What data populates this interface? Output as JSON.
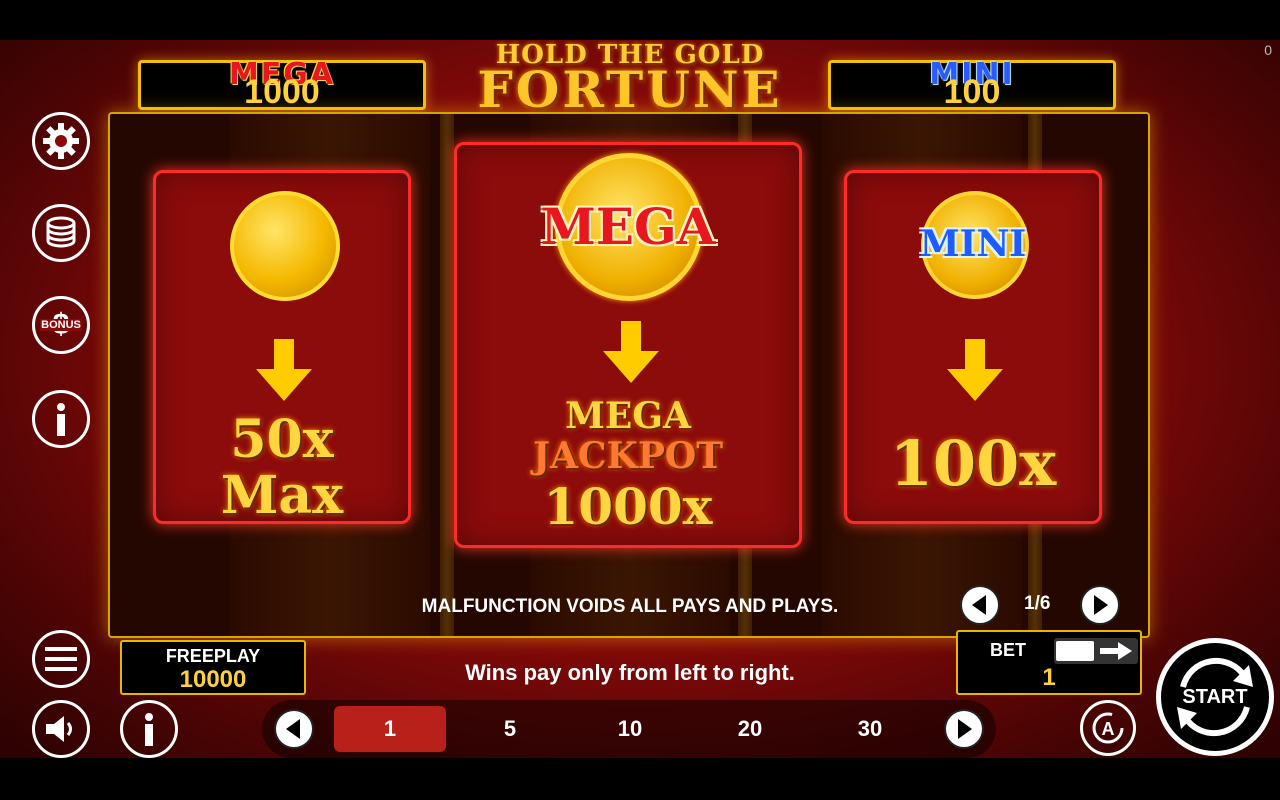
{
  "jackpots": {
    "mega": {
      "label": "MEGA",
      "value": "1000"
    },
    "mini": {
      "label": "MINI",
      "value": "100"
    }
  },
  "logo": {
    "line1": "HOLD THE GOLD",
    "line2": "FORTUNE"
  },
  "corner_counter": "0",
  "panels": {
    "left": {
      "line1": "50x",
      "line2": "Max"
    },
    "center": {
      "coin_label": "MEGA",
      "line1": "MEGA",
      "line2": "JACKPOT",
      "line3": "1000x"
    },
    "right": {
      "coin_label": "MINI",
      "line1": "100x"
    }
  },
  "disclaimer": "MALFUNCTION VOIDS ALL PAYS AND PLAYS.",
  "pager": {
    "current": "1/6"
  },
  "side_menu": {
    "bonus_label": "BONUS"
  },
  "freeplay": {
    "label": "FREEPLAY",
    "value": "10000"
  },
  "wins_text": "Wins pay only from left to right.",
  "bet": {
    "label": "BET",
    "value": "1"
  },
  "bet_options": [
    "1",
    "5",
    "10",
    "20",
    "30"
  ],
  "bet_selected": "1",
  "start_label": "START",
  "colors": {
    "accent_gold": "#ffd23d",
    "panel_red": "#8c0b0b",
    "border_red": "#ff2a2a"
  }
}
